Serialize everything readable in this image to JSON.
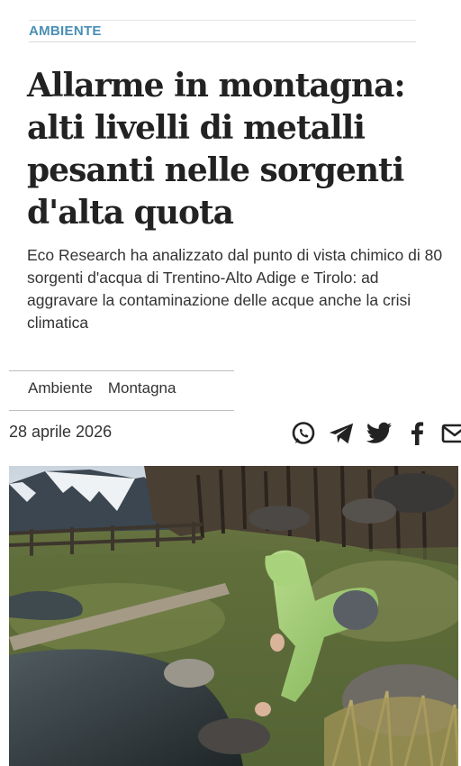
{
  "section": {
    "label": "AMBIENTE"
  },
  "article": {
    "headline": "Allarme in montagna: alti livelli di metalli pesanti nelle sorgenti d'alta quota",
    "subtitle": "Eco Research ha analizzato dal punto di vista chimico di 80 sorgenti d'acqua di Trentino-Alto Adige e Tirolo: ad aggravare la contaminazione delle acque anche la crisi climatica",
    "tags": [
      "Ambiente",
      "Montagna"
    ],
    "date": "28 aprile 2026"
  },
  "share": {
    "icons": [
      "whatsapp-icon",
      "telegram-icon",
      "twitter-icon",
      "facebook-icon",
      "mail-icon"
    ]
  },
  "colors": {
    "section_accent": "#4a8fb5",
    "text": "#222222"
  }
}
